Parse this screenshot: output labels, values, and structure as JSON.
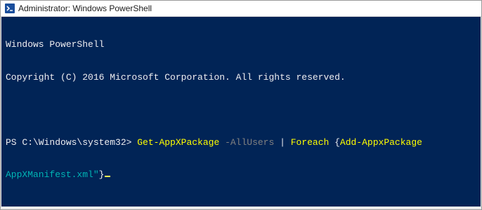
{
  "window": {
    "title": "Administrator: Windows PowerShell",
    "icon": "powershell-icon"
  },
  "console": {
    "header_line_1": "Windows PowerShell",
    "header_line_2": "Copyright (C) 2016 Microsoft Corporation. All rights reserved.",
    "prompt": "PS C:\\Windows\\system32> ",
    "cmd1": "Get-AppXPackage",
    "param1": " -AllUsers",
    "pipe": " | ",
    "cmd2": "Foreach",
    "brace_open": " {",
    "cmd3": "Add-AppxPackage",
    "wrapped_string": "AppXManifest.xml\"",
    "brace_close": "}"
  },
  "colors": {
    "console_background": "#012456",
    "command": "#ffff00",
    "parameter": "#808080",
    "string": "#00b5b5",
    "text": "#eeedf0"
  }
}
